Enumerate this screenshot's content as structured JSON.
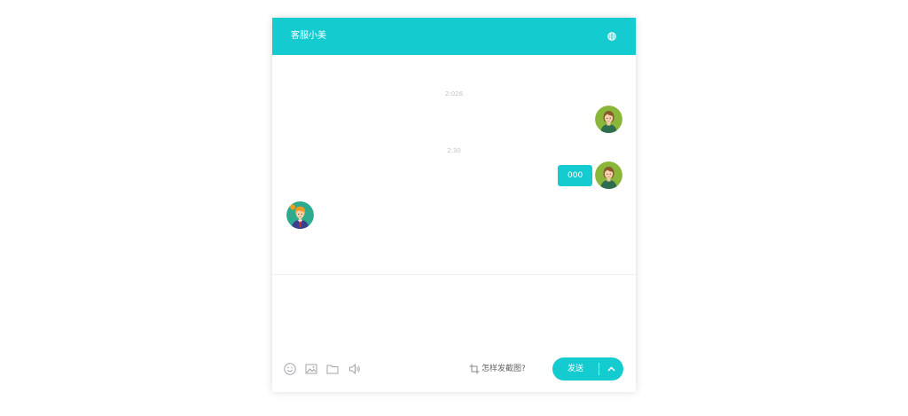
{
  "header": {
    "title": "客服小美",
    "globe_icon": "globe-icon",
    "background": "#14cbcf"
  },
  "messages": [
    {
      "type": "timestamp",
      "text": "2:026"
    },
    {
      "type": "outgoing",
      "sender": "user",
      "avatar": "user-avatar",
      "text": ""
    },
    {
      "type": "timestamp",
      "text": "2:30"
    },
    {
      "type": "outgoing",
      "sender": "user",
      "avatar": "user-avatar",
      "text": "000"
    },
    {
      "type": "incoming",
      "sender": "agent",
      "avatar": "agent-avatar",
      "text": ""
    }
  ],
  "input": {
    "value": "",
    "placeholder": ""
  },
  "toolbar": {
    "icons": [
      "emoji-icon",
      "image-icon",
      "folder-icon",
      "voice-icon"
    ],
    "screenshot_help": "怎样发截图?",
    "send_label": "发送",
    "send_options_icon": "chevron-up-icon"
  },
  "colors": {
    "accent": "#14cbcf",
    "timestamp": "#c4c4c4",
    "icon": "#a0a4a8"
  }
}
